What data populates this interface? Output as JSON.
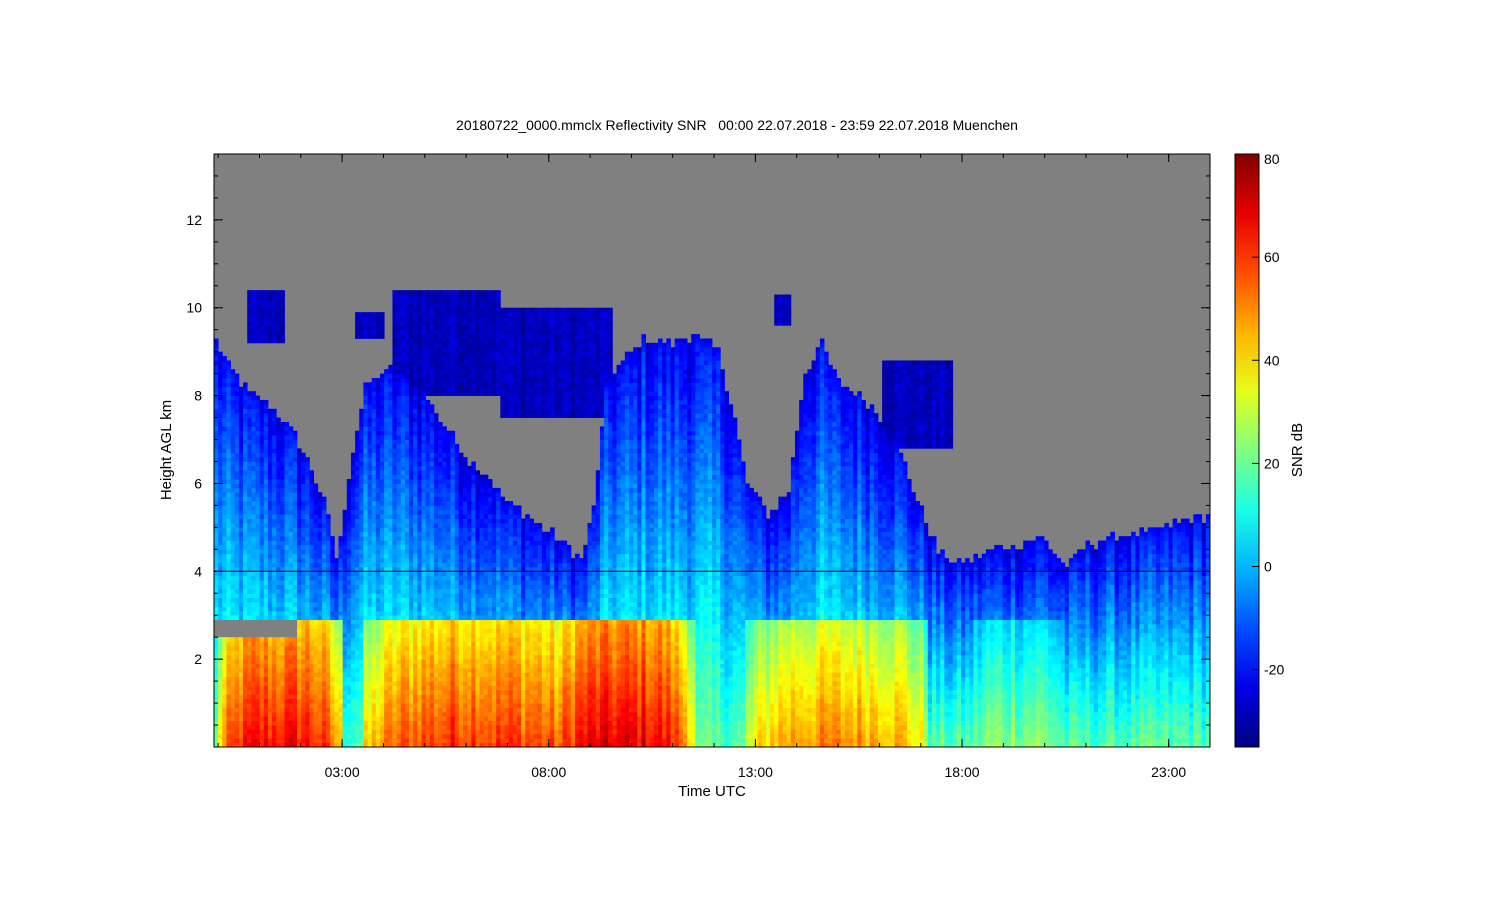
{
  "chart_data": {
    "type": "heatmap",
    "title": "20180722_0000.mmclx Reflectivity SNR   00:00 22.07.2018 - 23:59 22.07.2018 Muenchen",
    "xlabel": "Time UTC",
    "ylabel": "Height AGL km",
    "x_unit": "hours UTC",
    "xlim": [
      -0.1,
      24.0
    ],
    "ylim": [
      0.0,
      13.5
    ],
    "x_ticks": [
      {
        "value": 3,
        "label": "03:00"
      },
      {
        "value": 8,
        "label": "08:00"
      },
      {
        "value": 13,
        "label": "13:00"
      },
      {
        "value": 18,
        "label": "18:00"
      },
      {
        "value": 23,
        "label": "23:00"
      }
    ],
    "y_ticks": [
      {
        "value": 2,
        "label": "2"
      },
      {
        "value": 4,
        "label": "4"
      },
      {
        "value": 6,
        "label": "6"
      },
      {
        "value": 8,
        "label": "8"
      },
      {
        "value": 10,
        "label": "10"
      },
      {
        "value": 12,
        "label": "12"
      }
    ],
    "colorbar": {
      "label": "SNR dB",
      "range": [
        -35,
        80
      ],
      "ticks": [
        {
          "value": -20,
          "label": "-20"
        },
        {
          "value": 0,
          "label": "0"
        },
        {
          "value": 20,
          "label": "20"
        },
        {
          "value": 40,
          "label": "40"
        },
        {
          "value": 60,
          "label": "60"
        },
        {
          "value": 80,
          "label": "80"
        }
      ],
      "colormap": "jet"
    },
    "no_data_color": "#808080",
    "reference_line_km": 4.0,
    "cloud_top_profile": [
      [
        -0.1,
        9.4
      ],
      [
        0.2,
        8.8
      ],
      [
        0.6,
        8.2
      ],
      [
        1.2,
        7.8
      ],
      [
        1.8,
        7.2
      ],
      [
        2.2,
        6.5
      ],
      [
        2.6,
        5.5
      ],
      [
        2.9,
        4.2
      ],
      [
        3.2,
        6.5
      ],
      [
        3.6,
        8.3
      ],
      [
        4.2,
        8.6
      ],
      [
        5.0,
        8.0
      ],
      [
        5.5,
        7.3
      ],
      [
        6.0,
        6.6
      ],
      [
        6.5,
        6.2
      ],
      [
        7.0,
        5.6
      ],
      [
        7.6,
        5.2
      ],
      [
        8.0,
        4.9
      ],
      [
        8.4,
        4.6
      ],
      [
        8.8,
        4.3
      ],
      [
        9.1,
        5.5
      ],
      [
        9.4,
        8.3
      ],
      [
        9.8,
        8.8
      ],
      [
        10.3,
        9.3
      ],
      [
        11.0,
        9.2
      ],
      [
        11.5,
        9.4
      ],
      [
        12.1,
        9.0
      ],
      [
        12.5,
        7.5
      ],
      [
        12.8,
        6.0
      ],
      [
        13.3,
        5.3
      ],
      [
        13.8,
        5.8
      ],
      [
        14.2,
        8.5
      ],
      [
        14.6,
        9.2
      ],
      [
        15.0,
        8.3
      ],
      [
        15.6,
        8.0
      ],
      [
        16.1,
        7.4
      ],
      [
        16.6,
        6.5
      ],
      [
        17.0,
        5.4
      ],
      [
        17.4,
        4.5
      ],
      [
        17.8,
        4.2
      ],
      [
        18.3,
        4.3
      ],
      [
        18.8,
        4.5
      ],
      [
        19.4,
        4.6
      ],
      [
        19.9,
        4.8
      ],
      [
        20.5,
        4.1
      ],
      [
        21.0,
        4.6
      ],
      [
        21.8,
        4.8
      ],
      [
        22.5,
        4.9
      ],
      [
        23.2,
        5.1
      ],
      [
        24.0,
        5.3
      ]
    ],
    "upper_cloud_patches": [
      {
        "x": [
          0.7,
          1.6
        ],
        "y": [
          9.2,
          10.4
        ]
      },
      {
        "x": [
          3.3,
          4.0
        ],
        "y": [
          9.3,
          9.9
        ]
      },
      {
        "x": [
          4.2,
          6.8
        ],
        "y": [
          8.0,
          10.4
        ]
      },
      {
        "x": [
          6.8,
          9.5
        ],
        "y": [
          7.5,
          10.0
        ]
      },
      {
        "x": [
          13.5,
          13.9
        ],
        "y": [
          9.6,
          10.3
        ]
      },
      {
        "x": [
          16.1,
          17.8
        ],
        "y": [
          6.8,
          8.8
        ]
      }
    ],
    "low_cloud_patches": [
      {
        "x": [
          20.7,
          24.0
        ],
        "y": [
          0.2,
          2.1
        ]
      }
    ],
    "gaps": [
      {
        "x": [
          -0.1,
          1.9
        ],
        "y": [
          2.55,
          2.85
        ]
      }
    ],
    "precip_periods": [
      {
        "x": [
          0.0,
          3.0
        ],
        "max_snr": 65
      },
      {
        "x": [
          3.5,
          9.0
        ],
        "max_snr": 60
      },
      {
        "x": [
          5.0,
          7.0
        ],
        "max_snr": 62
      },
      {
        "x": [
          8.0,
          11.5
        ],
        "max_snr": 68
      },
      {
        "x": [
          12.8,
          17.2
        ],
        "max_snr": 50
      },
      {
        "x": [
          18.2,
          20.5
        ],
        "max_snr": 25
      }
    ],
    "annotations": []
  }
}
